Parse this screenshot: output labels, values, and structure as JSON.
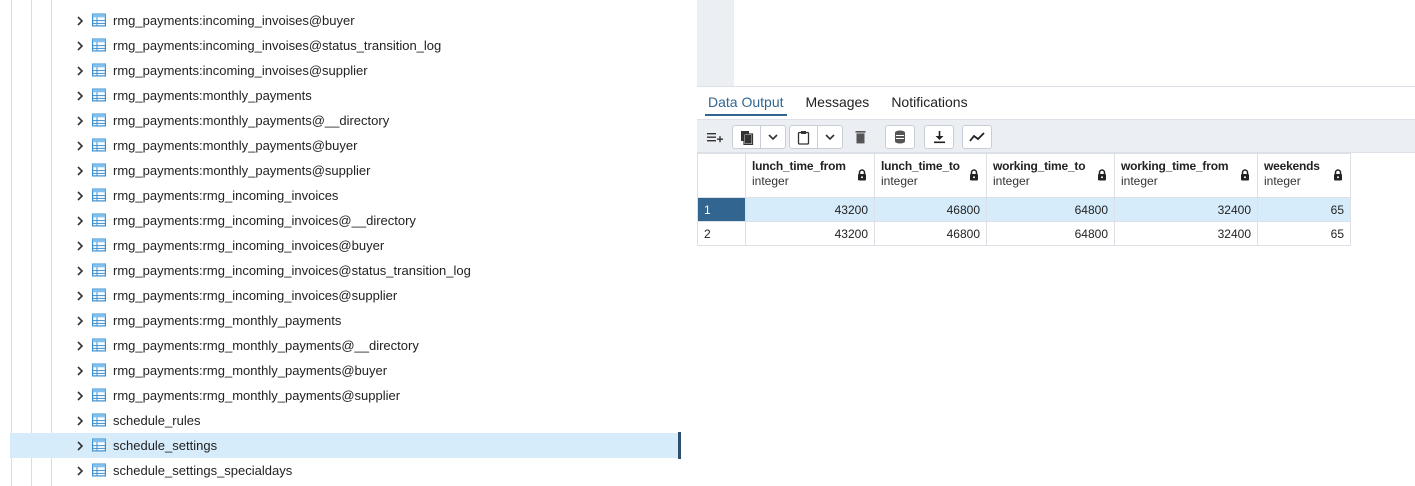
{
  "tree": {
    "items": [
      {
        "label": "rmg_payments:incoming_invoises@buyer"
      },
      {
        "label": "rmg_payments:incoming_invoises@status_transition_log"
      },
      {
        "label": "rmg_payments:incoming_invoises@supplier"
      },
      {
        "label": "rmg_payments:monthly_payments"
      },
      {
        "label": "rmg_payments:monthly_payments@__directory"
      },
      {
        "label": "rmg_payments:monthly_payments@buyer"
      },
      {
        "label": "rmg_payments:monthly_payments@supplier"
      },
      {
        "label": "rmg_payments:rmg_incoming_invoices"
      },
      {
        "label": "rmg_payments:rmg_incoming_invoices@__directory"
      },
      {
        "label": "rmg_payments:rmg_incoming_invoices@buyer"
      },
      {
        "label": "rmg_payments:rmg_incoming_invoices@status_transition_log"
      },
      {
        "label": "rmg_payments:rmg_incoming_invoices@supplier"
      },
      {
        "label": "rmg_payments:rmg_monthly_payments"
      },
      {
        "label": "rmg_payments:rmg_monthly_payments@__directory"
      },
      {
        "label": "rmg_payments:rmg_monthly_payments@buyer"
      },
      {
        "label": "rmg_payments:rmg_monthly_payments@supplier"
      },
      {
        "label": "schedule_rules"
      },
      {
        "label": "schedule_settings",
        "selected": true
      },
      {
        "label": "schedule_settings_specialdays"
      }
    ],
    "icons": {
      "expand": "chevron-right-icon",
      "item": "table-icon"
    },
    "selection_color": "#d7ecfa"
  },
  "tabs": [
    {
      "label": "Data Output",
      "active": true
    },
    {
      "label": "Messages"
    },
    {
      "label": "Notifications"
    }
  ],
  "toolbar": {
    "icons": [
      "add-row-icon",
      "copy-icon",
      "copy-dropdown-icon",
      "paste-icon",
      "paste-dropdown-icon",
      "delete-icon",
      "save-data-icon",
      "download-icon",
      "graph-visualiser-icon"
    ]
  },
  "grid": {
    "columns": [
      {
        "name": "lunch_time_from",
        "type": "integer"
      },
      {
        "name": "lunch_time_to",
        "type": "integer"
      },
      {
        "name": "working_time_to",
        "type": "integer"
      },
      {
        "name": "working_time_from",
        "type": "integer"
      },
      {
        "name": "weekends",
        "type": "integer"
      }
    ],
    "rows": [
      {
        "num": "1",
        "cells": [
          "43200",
          "46800",
          "64800",
          "32400",
          "65"
        ],
        "selected": true
      },
      {
        "num": "2",
        "cells": [
          "43200",
          "46800",
          "64800",
          "32400",
          "65"
        ]
      }
    ],
    "lock_icon": "lock-icon",
    "accent_color": "#326690"
  }
}
